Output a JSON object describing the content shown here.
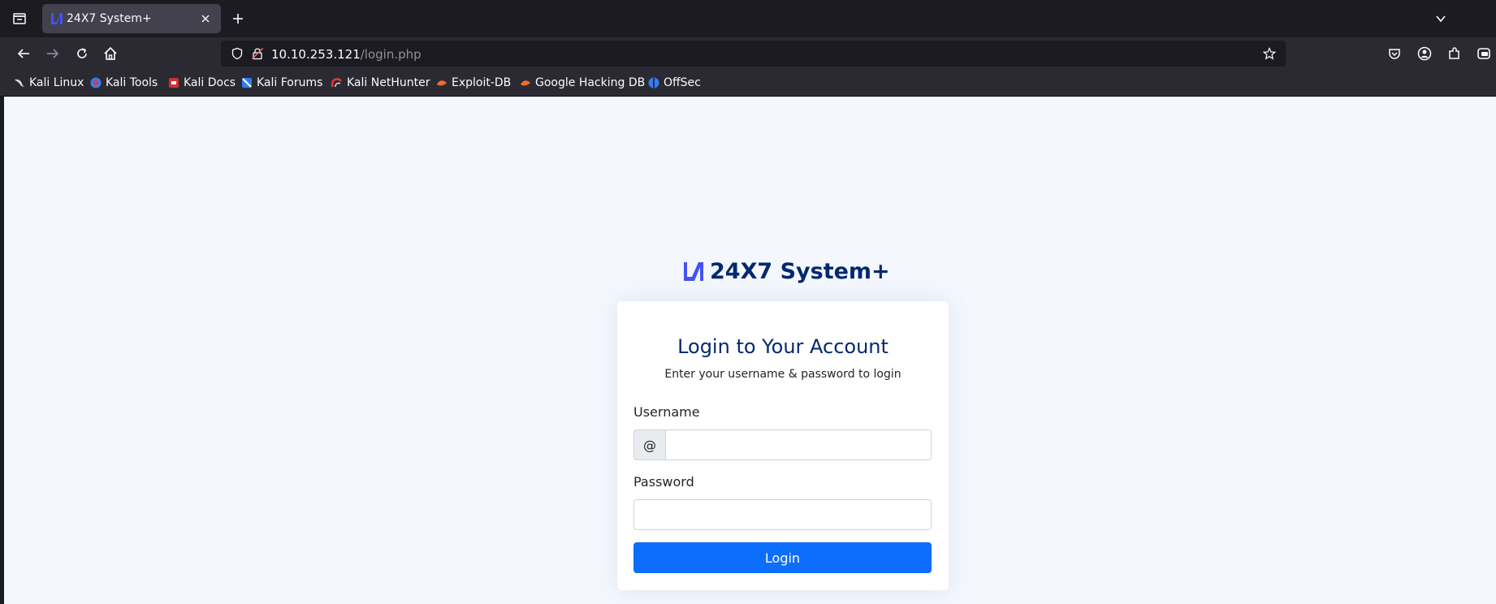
{
  "browser": {
    "tab": {
      "title": "24X7 System+"
    },
    "url": {
      "host": "10.10.253.121",
      "path": "/login.php"
    },
    "bookmarks": [
      {
        "label": "Kali Linux",
        "icon": "kali-dragon-icon"
      },
      {
        "label": "Kali Tools",
        "icon": "kali-tools-icon"
      },
      {
        "label": "Kali Docs",
        "icon": "kali-docs-icon"
      },
      {
        "label": "Kali Forums",
        "icon": "kali-forums-icon"
      },
      {
        "label": "Kali NetHunter",
        "icon": "kali-nethunter-icon"
      },
      {
        "label": "Exploit-DB",
        "icon": "exploit-db-icon"
      },
      {
        "label": "Google Hacking DB",
        "icon": "ghdb-icon"
      },
      {
        "label": "OffSec",
        "icon": "offsec-icon"
      }
    ]
  },
  "page": {
    "brand": {
      "name": "24X7 System+",
      "color": "#012970"
    },
    "login": {
      "title": "Login to Your Account",
      "subtitle": "Enter your username & password to login",
      "username_label": "Username",
      "username_prefix": "@",
      "username_value": "",
      "password_label": "Password",
      "password_value": "",
      "button_label": "Login",
      "button_color": "#0d6efd"
    }
  }
}
